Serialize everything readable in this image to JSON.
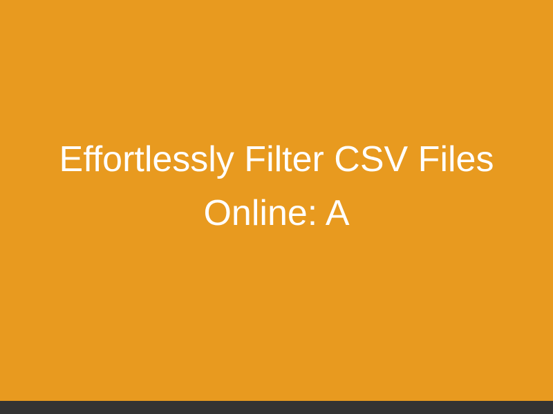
{
  "title": "Effortlessly Filter CSV Files Online: A",
  "colors": {
    "background": "#e89a1f",
    "text": "#ffffff",
    "bar": "#333333"
  }
}
